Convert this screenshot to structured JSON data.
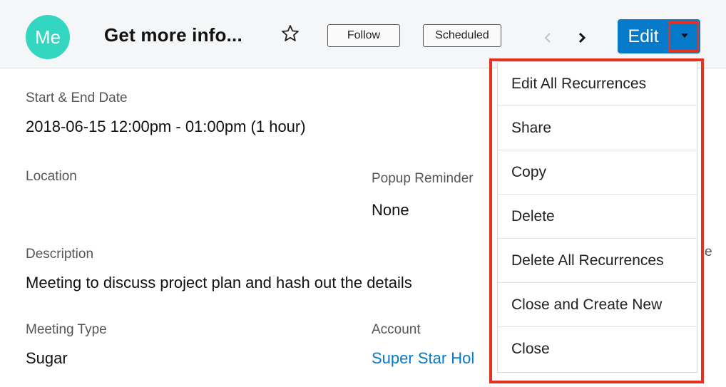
{
  "header": {
    "avatar_text": "Me",
    "title": "Get more info...",
    "follow_label": "Follow",
    "status_label": "Scheduled",
    "edit_label": "Edit"
  },
  "fields": {
    "start_end_label": "Start & End Date",
    "start_end_value": "2018-06-15 12:00pm - 01:00pm (1 hour)",
    "location_label": "Location",
    "popup_reminder_label": "Popup Reminder",
    "popup_reminder_value": "None",
    "description_label": "Description",
    "description_value": "Meeting to discuss project plan and hash out the details",
    "meeting_type_label": "Meeting Type",
    "meeting_type_value": "Sugar",
    "account_label": "Account",
    "account_value": "Super Star Hol",
    "partial_label_fragment": "e"
  },
  "menu": {
    "items": [
      "Edit All Recurrences",
      "Share",
      "Copy",
      "Delete",
      "Delete All Recurrences",
      "Close and Create New",
      "Close"
    ]
  },
  "colors": {
    "avatar": "#33d6c0",
    "primary_button": "#0679c8",
    "highlight": "#e8321f",
    "link": "#0679c8"
  },
  "icons": {
    "favorite": "star-icon",
    "previous": "chevron-left-icon",
    "next": "chevron-right-icon",
    "actions": "caret-down-icon"
  }
}
